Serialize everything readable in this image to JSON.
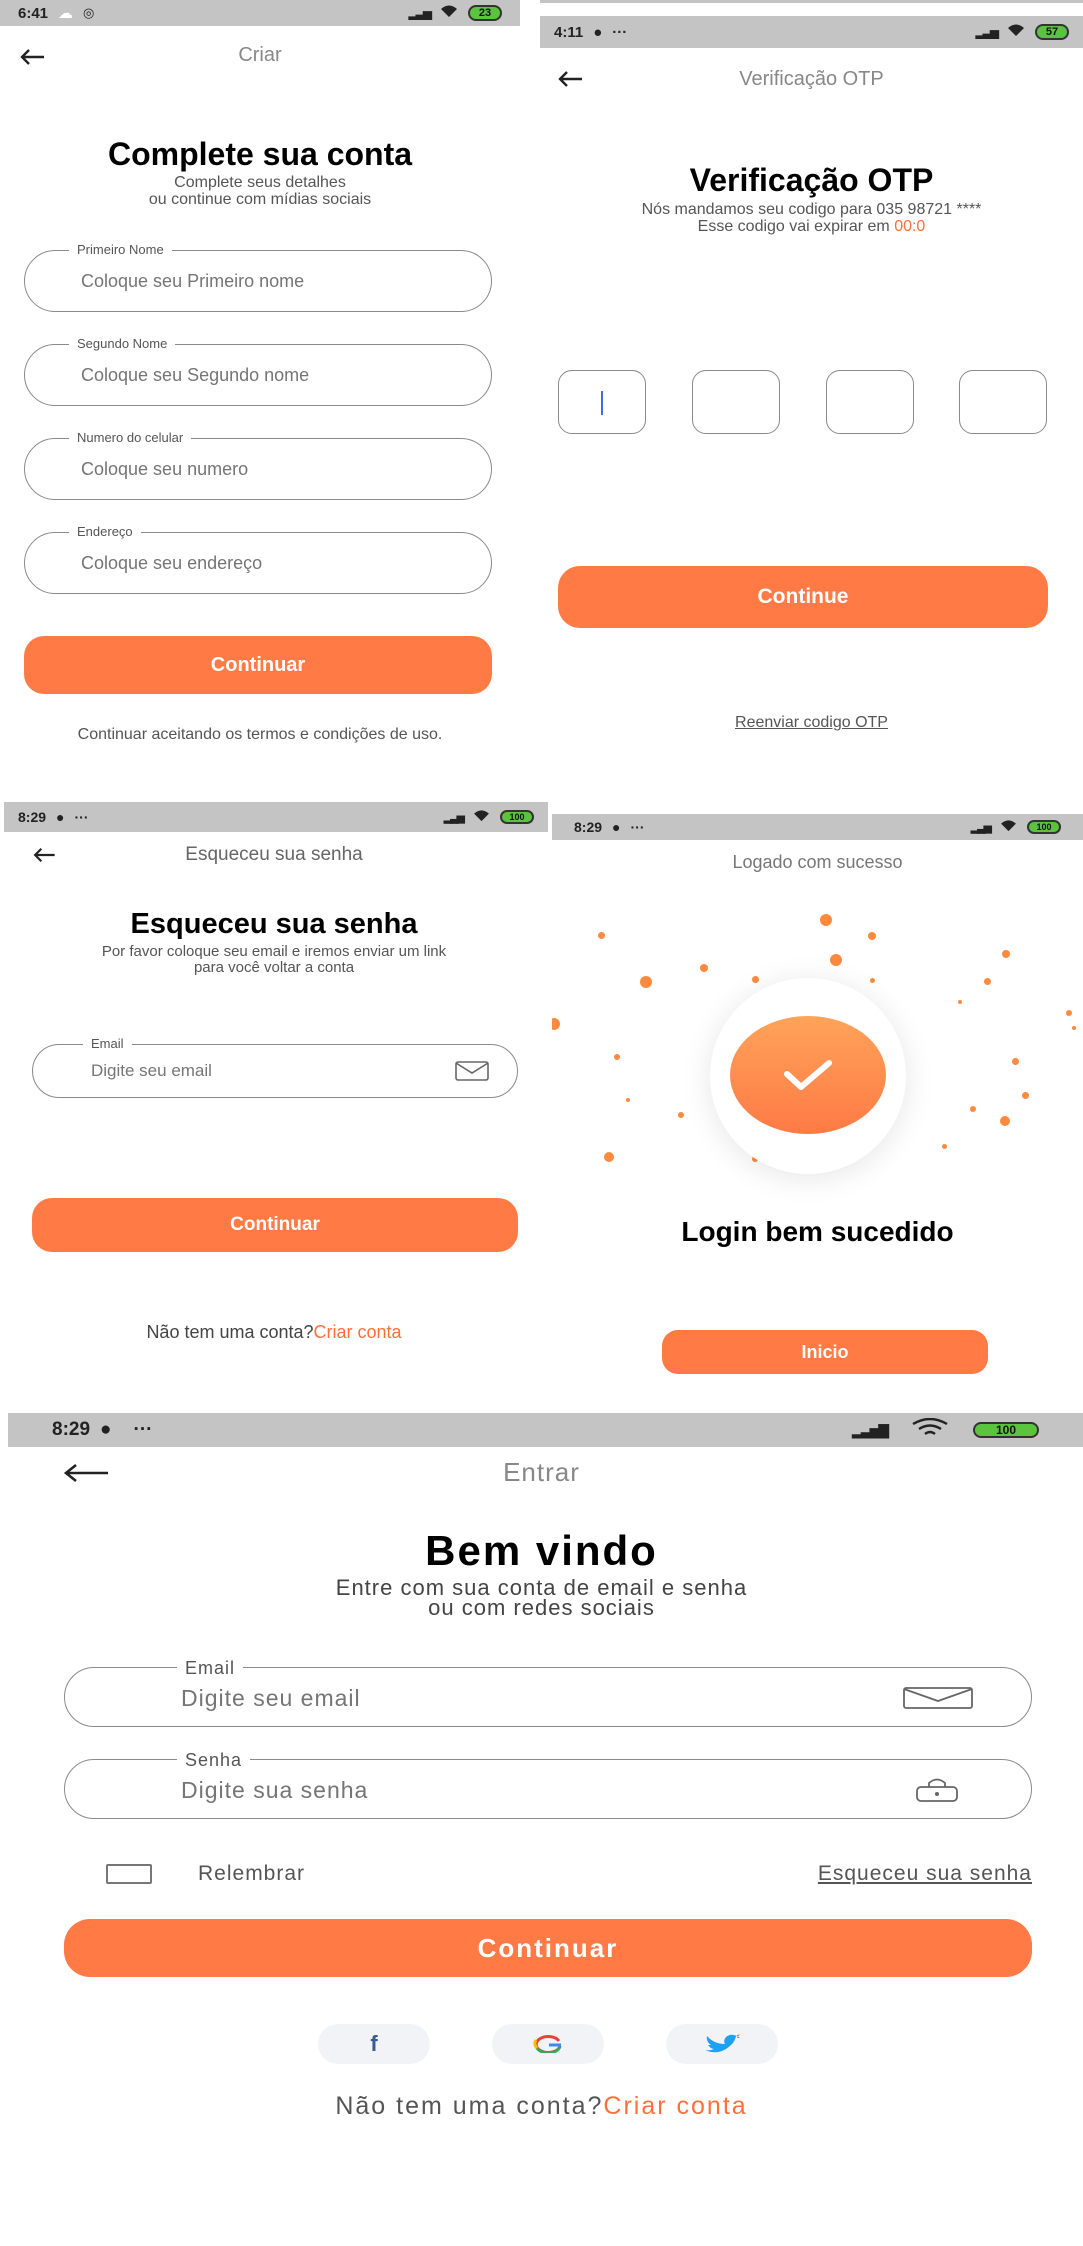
{
  "colors": {
    "accent": "#ff7a45",
    "status_bar": "#c4c4c4",
    "battery": "#5ac43f"
  },
  "create_account": {
    "status": {
      "time": "6:41",
      "battery": "23"
    },
    "header_title": "Criar",
    "title": "Complete sua conta",
    "subtitle_line1": "Complete seus detalhes",
    "subtitle_line2": "ou continue com mídias sociais",
    "fields": [
      {
        "label": "Primeiro Nome",
        "placeholder": "Coloque seu Primeiro nome"
      },
      {
        "label": "Segundo Nome",
        "placeholder": "Coloque seu Segundo nome"
      },
      {
        "label": "Numero do celular",
        "placeholder": "Coloque seu numero"
      },
      {
        "label": "Endereço",
        "placeholder": "Coloque seu endereço"
      }
    ],
    "button": "Continuar",
    "terms": "Continuar aceitando os termos e condições de uso."
  },
  "otp": {
    "status": {
      "time": "4:11",
      "battery": "57"
    },
    "header_title": "Verificação OTP",
    "title": "Verificação OTP",
    "line1": "Nós mandamos seu codigo para 035 98721 ****",
    "line2_prefix": "Esse codigo vai expirar em ",
    "timer": "00:0",
    "button": "Continue",
    "resend": "Reenviar codigo OTP"
  },
  "forgot": {
    "status": {
      "time": "8:29",
      "battery": "100"
    },
    "header_title": "Esqueceu sua senha",
    "title": "Esqueceu sua senha",
    "line1": "Por favor coloque seu email e iremos enviar um link",
    "line2": "para você voltar a conta",
    "email_label": "Email",
    "email_placeholder": "Digite seu email",
    "button": "Continuar",
    "no_account": "Não tem uma conta?",
    "create_link": "Criar conta"
  },
  "success": {
    "status": {
      "time": "8:29",
      "battery": "100"
    },
    "header_title": "Logado com sucesso",
    "title": "Login bem sucedido",
    "button": "Inicio"
  },
  "login": {
    "status": {
      "time": "8:29",
      "battery": "100"
    },
    "header_title": "Entrar",
    "title": "Bem vindo",
    "line1": "Entre com sua conta de email e senha",
    "line2": "ou com redes sociais",
    "email_label": "Email",
    "email_placeholder": "Digite seu email",
    "password_label": "Senha",
    "password_placeholder": "Digite sua senha",
    "remember": "Relembrar",
    "forgot_link": "Esqueceu sua senha",
    "button": "Continuar",
    "no_account": "Não tem uma conta?",
    "create_link": "Criar conta"
  }
}
